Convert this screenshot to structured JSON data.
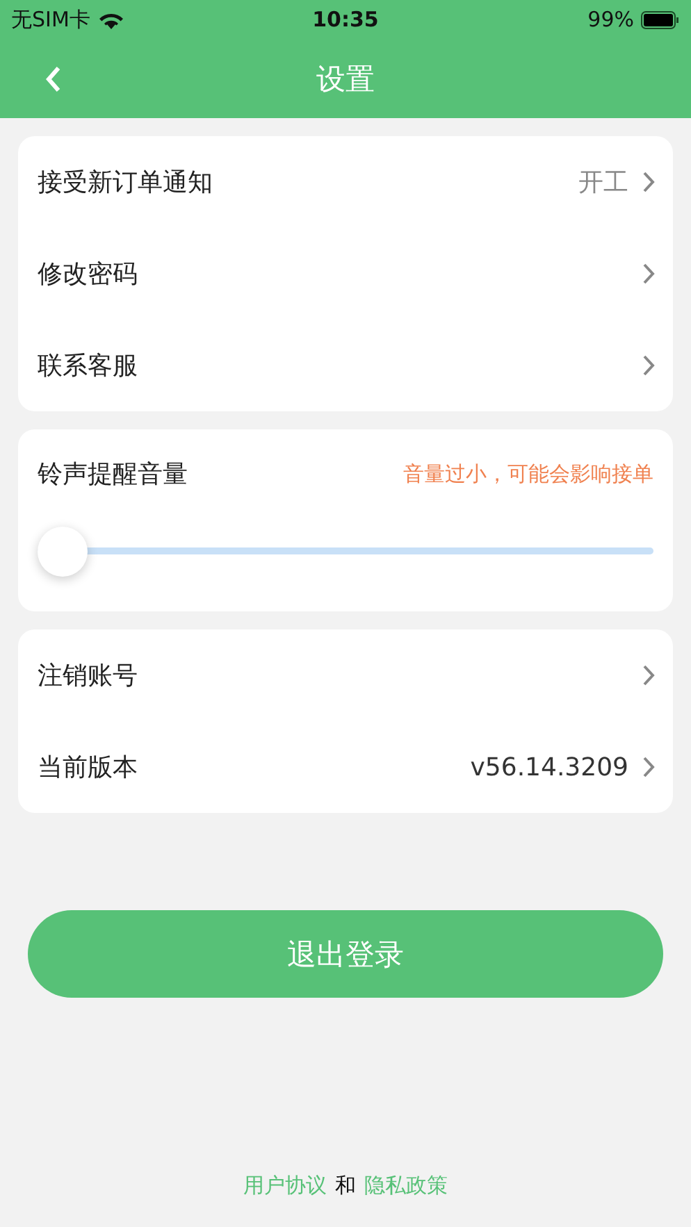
{
  "status_bar": {
    "carrier": "无SIM卡",
    "time": "10:35",
    "battery": "99%"
  },
  "nav": {
    "title": "设置"
  },
  "group_1": [
    {
      "label": "接受新订单通知",
      "value": "开工"
    },
    {
      "label": "修改密码"
    },
    {
      "label": "联系客服"
    }
  ],
  "volume": {
    "label": "铃声提醒音量",
    "warning": "音量过小，可能会影响接单",
    "level": 0
  },
  "group_2": [
    {
      "label": "注销账号"
    },
    {
      "label": "当前版本",
      "value": "v56.14.3209"
    }
  ],
  "logout_button": "退出登录",
  "footer": {
    "link_1": "用户协议",
    "joiner": "和",
    "link_2": "隐私政策"
  }
}
